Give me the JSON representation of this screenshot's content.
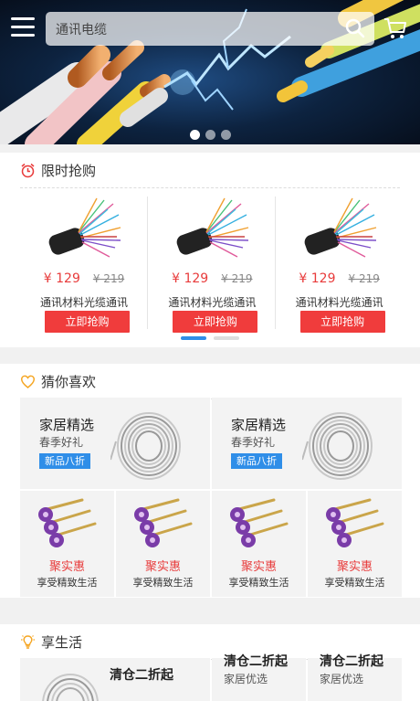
{
  "header": {
    "search": {
      "value": "通讯电缆"
    }
  },
  "banner": {
    "dots": [
      true,
      false,
      false
    ]
  },
  "flash_sale": {
    "title": "限时抢购",
    "items": [
      {
        "price": "¥ 129",
        "old_price": "¥ 219",
        "name": "通讯材料光缆通讯",
        "button": "立即抢购"
      },
      {
        "price": "¥ 129",
        "old_price": "¥ 219",
        "name": "通讯材料光缆通讯",
        "button": "立即抢购"
      },
      {
        "price": "¥ 129",
        "old_price": "¥ 219",
        "name": "通讯材料光缆通讯",
        "button": "立即抢购"
      }
    ]
  },
  "guess": {
    "title": "猜你喜欢",
    "big": [
      {
        "title": "家居精选",
        "subtitle": "春季好礼",
        "tag": "新品八折"
      },
      {
        "title": "家居精选",
        "subtitle": "春季好礼",
        "tag": "新品八折"
      }
    ],
    "small": [
      {
        "title": "聚实惠",
        "subtitle": "享受精致生活"
      },
      {
        "title": "聚实惠",
        "subtitle": "享受精致生活"
      },
      {
        "title": "聚实惠",
        "subtitle": "享受精致生活"
      },
      {
        "title": "聚实惠",
        "subtitle": "享受精致生活"
      }
    ]
  },
  "life": {
    "title": "享生活",
    "cards": [
      {
        "title": "清仓二折起"
      },
      {
        "title": "清仓二折起",
        "subtitle": "家居优选"
      },
      {
        "title": "清仓二折起",
        "subtitle": "家居优选"
      }
    ]
  },
  "colors": {
    "accent_red": "#f03c3c",
    "accent_blue": "#2f8ee8",
    "heart_orange": "#f5a623"
  }
}
